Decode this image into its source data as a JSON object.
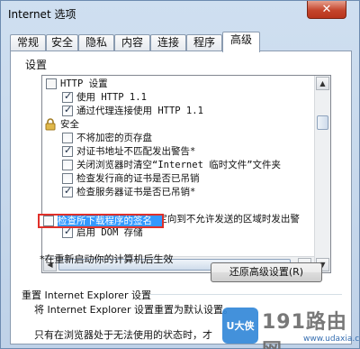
{
  "window": {
    "title": "Internet 选项",
    "close_label": "✕"
  },
  "tabs": [
    {
      "label": "常规"
    },
    {
      "label": "安全"
    },
    {
      "label": "隐私"
    },
    {
      "label": "内容"
    },
    {
      "label": "连接"
    },
    {
      "label": "程序"
    },
    {
      "label": "高级",
      "active": true
    }
  ],
  "settings": {
    "label": "设置",
    "items": [
      {
        "text": "HTTP 设置",
        "type": "group"
      },
      {
        "text": "使用 HTTP 1.1",
        "type": "checkbox",
        "checked": true
      },
      {
        "text": "通过代理连接使用 HTTP 1.1",
        "type": "checkbox",
        "checked": true
      },
      {
        "text": "安全",
        "type": "group-lock"
      },
      {
        "text": "不将加密的页存盘",
        "type": "checkbox",
        "checked": false
      },
      {
        "text": "对证书地址不匹配发出警告*",
        "type": "checkbox",
        "checked": true
      },
      {
        "text": "关闭浏览器时清空“Internet 临时文件”文件夹",
        "type": "checkbox",
        "checked": false
      },
      {
        "text": "检查发行商的证书是否已吊销",
        "type": "checkbox",
        "checked": false
      },
      {
        "text": "检查服务器证书是否已吊销*",
        "type": "checkbox",
        "checked": true
      },
      {
        "text": "检查所下载程序的签名",
        "type": "checkbox",
        "checked": false,
        "selected": true
      },
      {
        "text": "将提交的 POST 重定向到不允许发送的区域时发出警",
        "type": "checkbox",
        "checked": true
      },
      {
        "text": "启用 DOM 存储",
        "type": "checkbox",
        "checked": true
      }
    ],
    "restart_note": "*在重新启动你的计算机后生效",
    "restore_button": "还原高级设置(R)"
  },
  "reset": {
    "title": "重置 Internet Explorer 设置",
    "desc": "将 Internet Explorer 设置重置为默认设置。",
    "desc2": "只有在浏览器处于无法使用的状态时，才"
  },
  "watermark": {
    "logo": "U大侠",
    "text": "191路由网",
    "url": "www.udaxia.com"
  }
}
